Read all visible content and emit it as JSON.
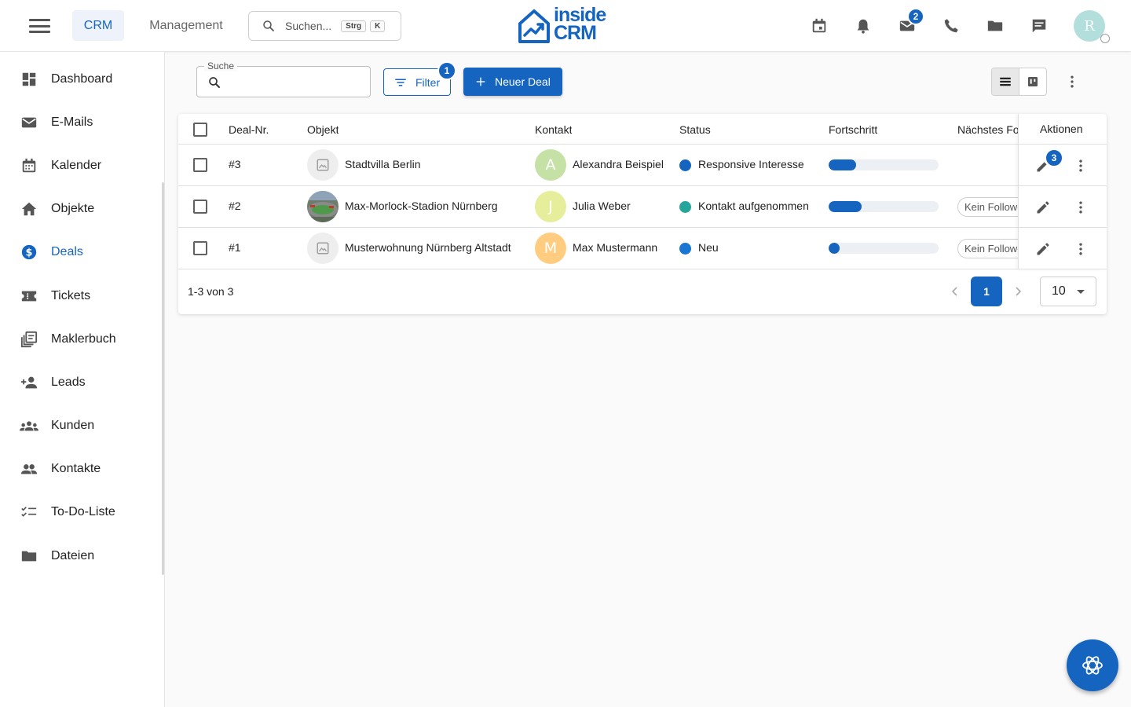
{
  "header": {
    "tabs": [
      {
        "label": "CRM",
        "active": true
      },
      {
        "label": "Management",
        "active": false
      }
    ],
    "search": {
      "placeholder": "Suchen...",
      "kbd1": "Strg",
      "kbd2": "K"
    },
    "logo": {
      "line1": "inside",
      "line2": "CRM"
    },
    "icons": {
      "calendar": "calendar-icon",
      "bell": "bell-icon",
      "mail": "mail-icon",
      "phone": "phone-icon",
      "folder": "folder-icon",
      "chat": "chat-icon"
    },
    "mail_badge": "2",
    "user_initial": "R"
  },
  "sidebar": {
    "items": [
      {
        "label": "Dashboard",
        "icon": "dashboard-icon",
        "active": false
      },
      {
        "label": "E-Mails",
        "icon": "mail-icon",
        "active": false
      },
      {
        "label": "Kalender",
        "icon": "calendar-icon",
        "active": false
      },
      {
        "label": "Objekte",
        "icon": "home-icon",
        "active": false
      },
      {
        "label": "Deals",
        "icon": "dollar-icon",
        "active": true
      },
      {
        "label": "Tickets",
        "icon": "ticket-icon",
        "active": false
      },
      {
        "label": "Maklerbuch",
        "icon": "library-icon",
        "active": false
      },
      {
        "label": "Leads",
        "icon": "person-add-icon",
        "active": false
      },
      {
        "label": "Kunden",
        "icon": "groups-icon",
        "active": false
      },
      {
        "label": "Kontakte",
        "icon": "people-icon",
        "active": false
      },
      {
        "label": "To-Do-Liste",
        "icon": "checklist-icon",
        "active": false
      },
      {
        "label": "Dateien",
        "icon": "folder-icon",
        "active": false
      }
    ]
  },
  "toolbar": {
    "search_label": "Suche",
    "filter_label": "Filter",
    "filter_badge": "1",
    "new_deal_label": "Neuer Deal"
  },
  "table": {
    "columns": {
      "deal_nr": "Deal-Nr.",
      "objekt": "Objekt",
      "kontakt": "Kontakt",
      "status": "Status",
      "fortschritt": "Fortschritt",
      "naechstes": "Nächstes Follow-up",
      "aktionen": "Aktionen"
    },
    "rows": [
      {
        "nr": "#3",
        "objekt": "Stadtvilla Berlin",
        "kontakt": "Alexandra Beispiel",
        "initial": "A",
        "avatar_color": "#c5e1a5",
        "status": "Responsive Interesse",
        "status_color": "#1565c0",
        "progress": 0.25,
        "followup": "",
        "edit_badge": "3",
        "has_image": false
      },
      {
        "nr": "#2",
        "objekt": "Max-Morlock-Stadion Nürnberg",
        "kontakt": "Julia Weber",
        "initial": "J",
        "avatar_color": "#e6ee9c",
        "status": "Kontakt aufgenommen",
        "status_color": "#26a69a",
        "progress": 0.3,
        "followup": "Kein Follow-up",
        "edit_badge": "",
        "has_image": true
      },
      {
        "nr": "#1",
        "objekt": "Musterwohnung Nürnberg Altstadt",
        "kontakt": "Max Mustermann",
        "initial": "M",
        "avatar_color": "#ffcc80",
        "status": "Neu",
        "status_color": "#1976d2",
        "progress": 0.1,
        "followup": "Kein Follow-up",
        "edit_badge": "",
        "has_image": false
      }
    ],
    "footer": {
      "range": "1-3 von 3",
      "page": "1",
      "per_page": "10"
    }
  }
}
